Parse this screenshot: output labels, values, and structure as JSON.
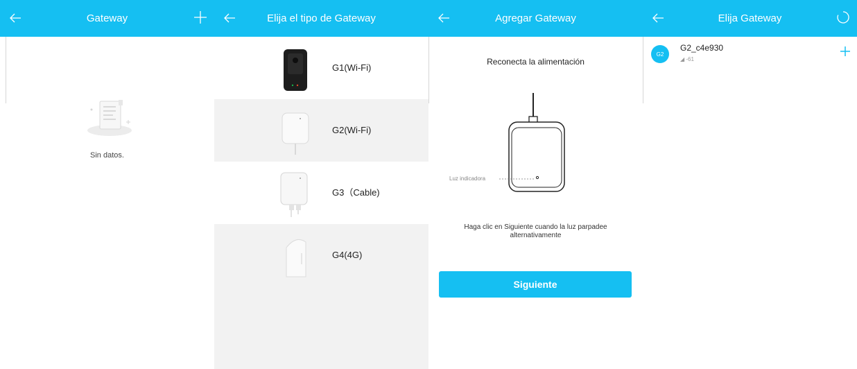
{
  "panel1": {
    "title": "Gateway",
    "empty_text": "Sin datos."
  },
  "panel2": {
    "title": "Elija el tipo de Gateway",
    "items": [
      {
        "label": "G1(Wi-Fi)"
      },
      {
        "label": "G2(Wi-Fi)"
      },
      {
        "label": "G3（Cable)"
      },
      {
        "label": "G4(4G)"
      }
    ]
  },
  "panel3": {
    "title": "Agregar Gateway",
    "instruction": "Reconecta la alimentación",
    "indicator_label": "Luz indicadora",
    "note": "Haga clic en Siguiente cuando la luz parpadee alternativamente",
    "next_button": "Siguiente"
  },
  "panel4": {
    "title": "Elija Gateway",
    "item": {
      "avatar_text": "G2",
      "name": "G2_c4e930",
      "signal": "-61"
    }
  },
  "colors": {
    "accent": "#15bff2",
    "panel_bg": "#f2f2f2"
  }
}
